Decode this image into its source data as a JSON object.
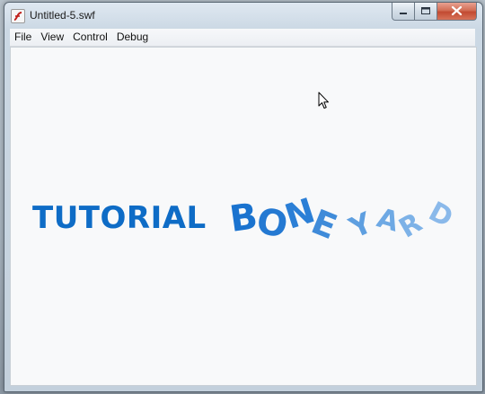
{
  "window": {
    "title": "Untitled-5.swf",
    "icon": "flash-player-icon"
  },
  "titlebar_controls": {
    "minimize_icon": "minimize-icon",
    "maximize_icon": "maximize-icon",
    "close_icon": "close-icon"
  },
  "menu": [
    {
      "label": "File"
    },
    {
      "label": "View"
    },
    {
      "label": "Control"
    },
    {
      "label": "Debug"
    }
  ],
  "stage": {
    "logo_text": "TUTORIAL",
    "boneyard_letters": [
      "B",
      "O",
      "N",
      "E",
      "Y",
      "A",
      "R",
      "D"
    ],
    "colors": {
      "logo": "#0e6cc6",
      "boneyard_dark": "#1a73cf",
      "boneyard_light": "#8ab9ea"
    }
  },
  "cursor": "arrow-cursor-icon"
}
